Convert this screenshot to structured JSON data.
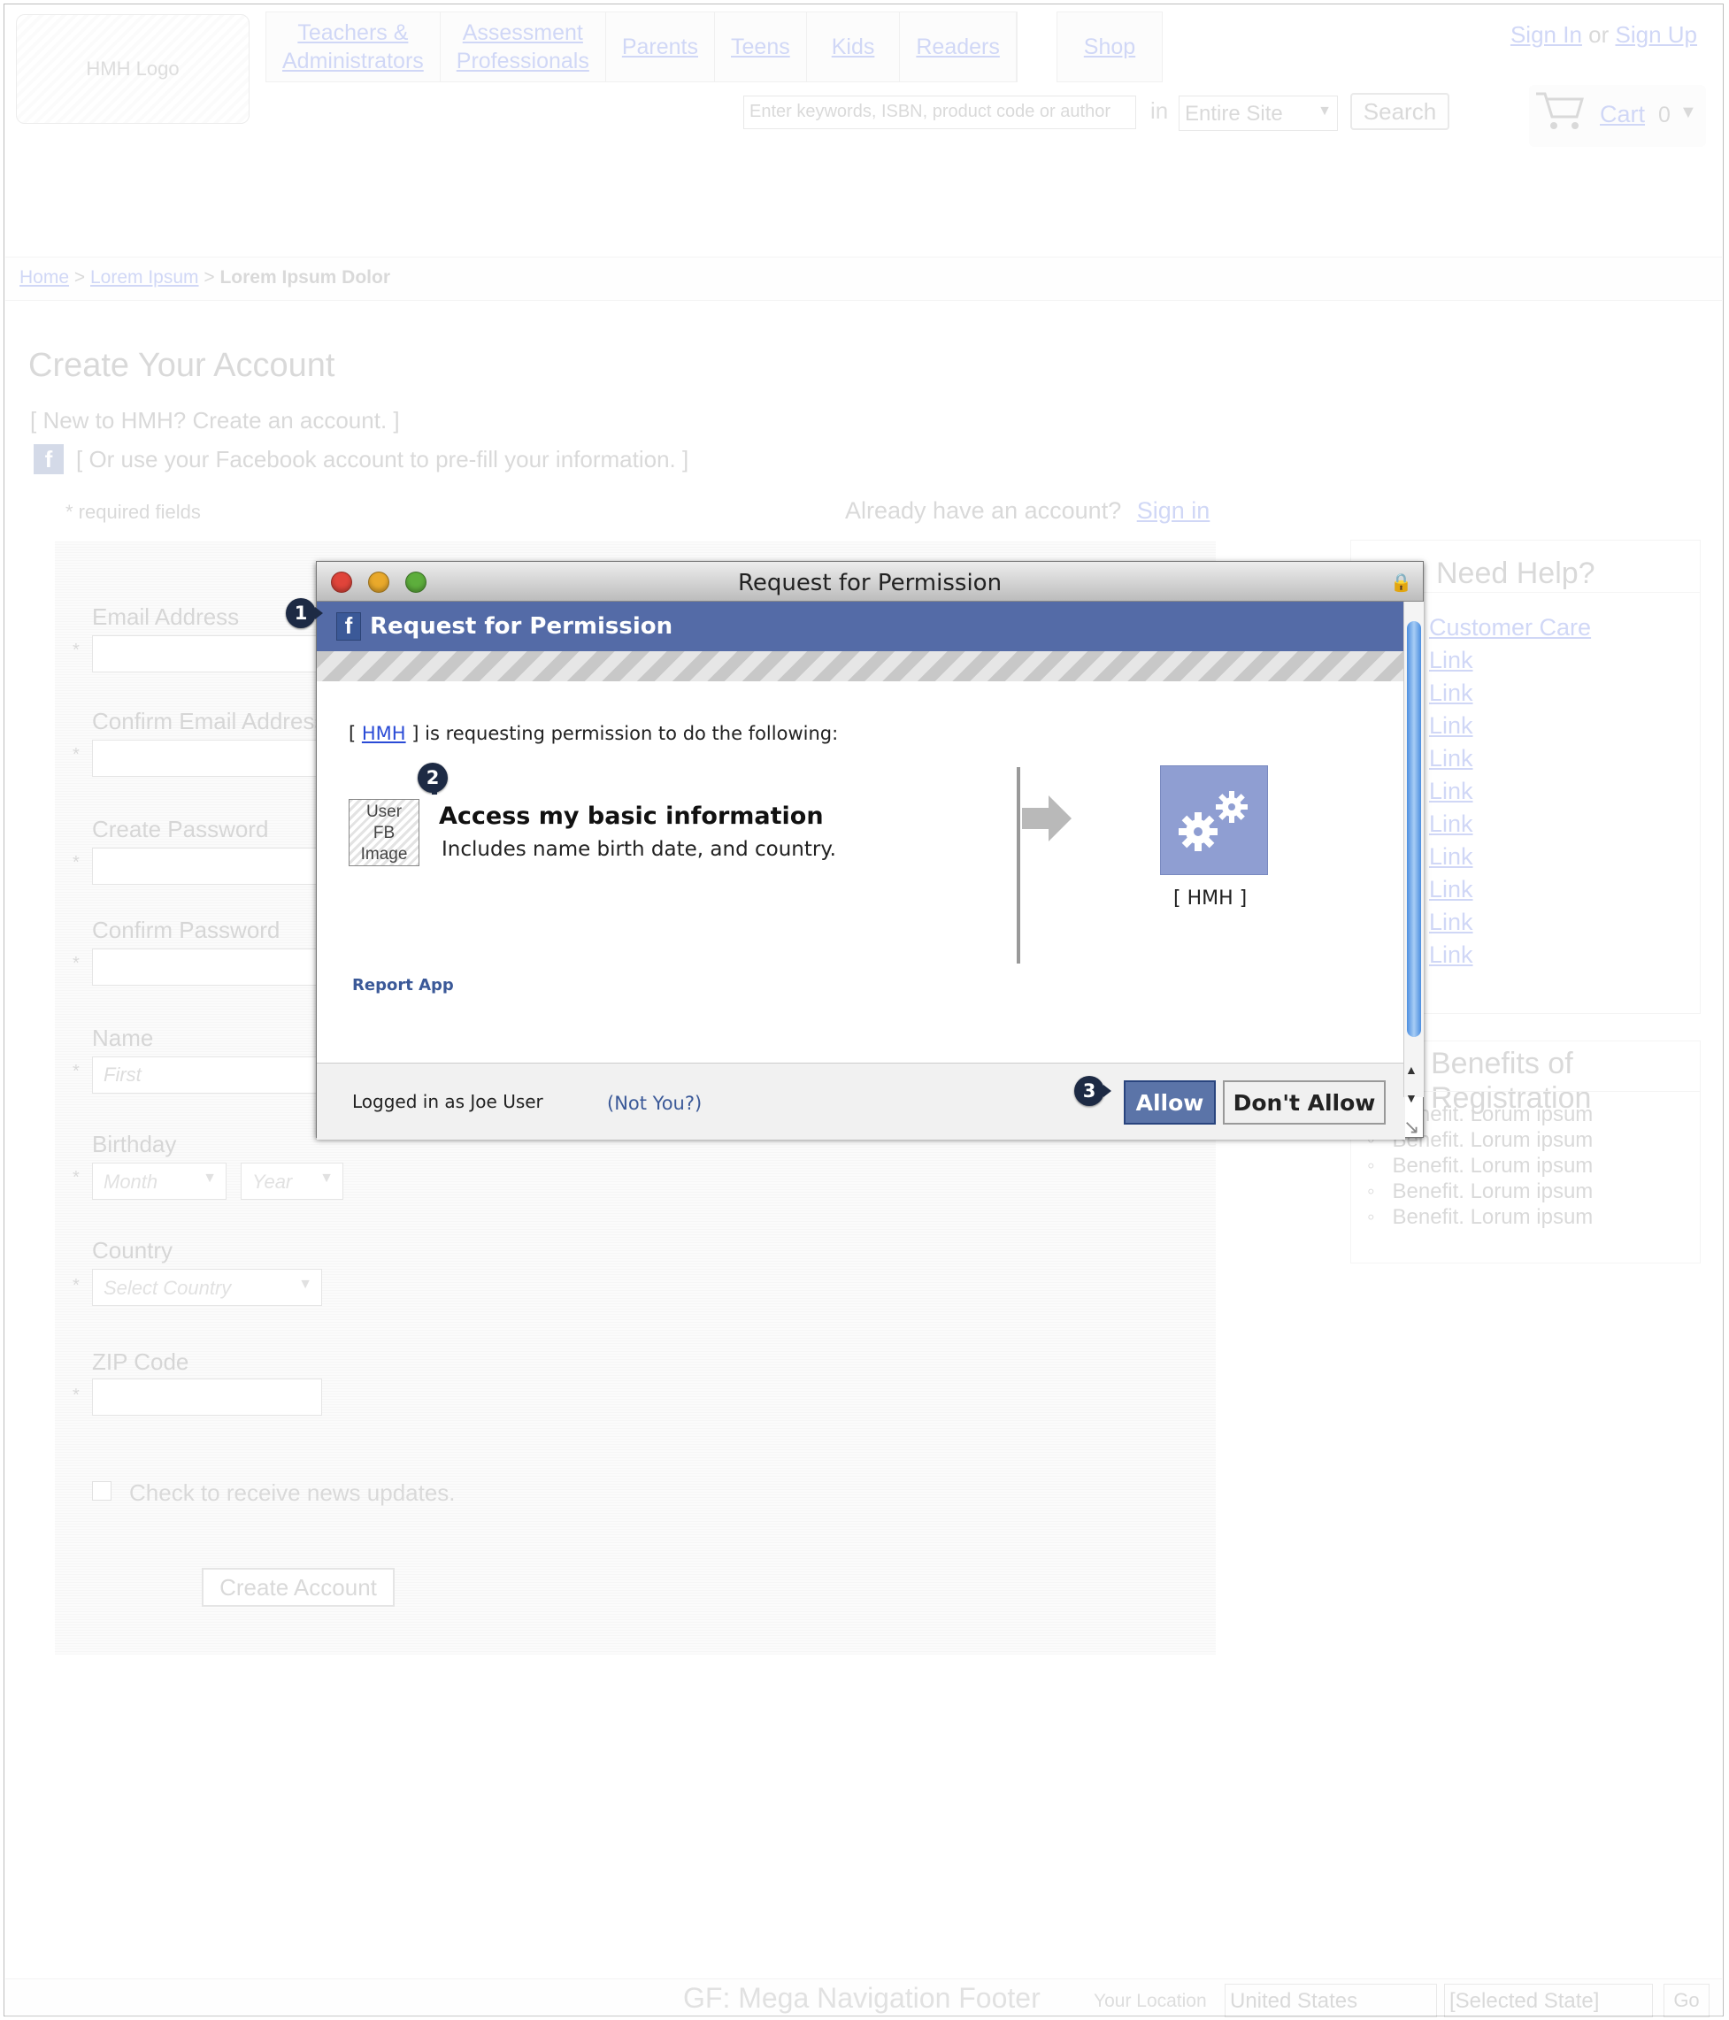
{
  "header": {
    "logo_text": "HMH Logo",
    "nav": [
      {
        "label": "Teachers &\nAdministrators"
      },
      {
        "label": "Assessment\nProfessionals"
      },
      {
        "label": "Parents"
      },
      {
        "label": "Teens"
      },
      {
        "label": "Kids"
      },
      {
        "label": "Readers"
      }
    ],
    "shop": "Shop",
    "sign_in": "Sign In",
    "or": "or",
    "sign_up": "Sign Up",
    "search_placeholder": "Enter keywords, ISBN, product code or author",
    "in_label": "in",
    "search_scope": "Entire Site",
    "search_button": "Search",
    "cart_label": "Cart",
    "cart_count": "0"
  },
  "breadcrumb": {
    "home": "Home",
    "sep1": ">",
    "level1": "Lorem Ipsum",
    "sep2": ">",
    "current": "Lorem Ipsum Dolor"
  },
  "form": {
    "title": "Create Your Account",
    "subtitle": "[ New to HMH?  Create an account. ]",
    "fb_prefill": "[ Or use your Facebook account to pre-fill your information. ]",
    "required_note": "* required fields",
    "already_text": "Already have an account?",
    "sign_in_link": "Sign in",
    "email_label": "Email Address",
    "confirm_email_label": "Confirm Email Address",
    "password_label": "Create Password",
    "confirm_password_label": "Confirm Password",
    "name_label": "Name",
    "first_placeholder": "First",
    "birthday_label": "Birthday",
    "month_placeholder": "Month",
    "year_placeholder": "Year",
    "country_label": "Country",
    "country_placeholder": "Select Country",
    "zip_label": "ZIP Code",
    "news_label": "Check to receive news updates.",
    "create_button": "Create Account",
    "star": "*"
  },
  "help": {
    "title": "Need Help?",
    "items": [
      "Customer Care",
      "Link",
      "Link",
      "Link",
      "Link",
      "Link",
      "Link",
      "Link",
      "Link",
      "Link",
      "Link"
    ]
  },
  "benefits": {
    "title": "Benefits of Registration",
    "items": [
      "Benefit.  Lorum ipsum",
      "Benefit.  Lorum ipsum",
      "Benefit.  Lorum ipsum",
      "Benefit.  Lorum ipsum",
      "Benefit.  Lorum ipsum"
    ]
  },
  "footer": {
    "title": "GF: Mega Navigation Footer",
    "location_label": "Your Location",
    "country": "United States",
    "state": "[Selected State]",
    "go": "Go"
  },
  "dialog": {
    "window_title": "Request for Permission",
    "fb_header": "Request for Permission",
    "request_prefix": "[",
    "app_link": "HMH",
    "request_suffix": "] is requesting permission to do the following:",
    "user_image": "User\nFB\nImage",
    "permission_title": "Access my basic information",
    "permission_desc": "Includes name birth date, and country.",
    "app_name": "[ HMH ]",
    "report": "Report App",
    "logged_in": "Logged in as Joe User",
    "not_you": "(Not You?)",
    "allow": "Allow",
    "dont_allow": "Don't Allow"
  },
  "callouts": [
    "1",
    "2",
    "3"
  ],
  "colors": {
    "facebook_blue": "#3b5998",
    "fb_header": "#546ba7",
    "allow_button": "#5b74a8",
    "callout": "#1d2a44",
    "link": "#2a4bd6"
  }
}
